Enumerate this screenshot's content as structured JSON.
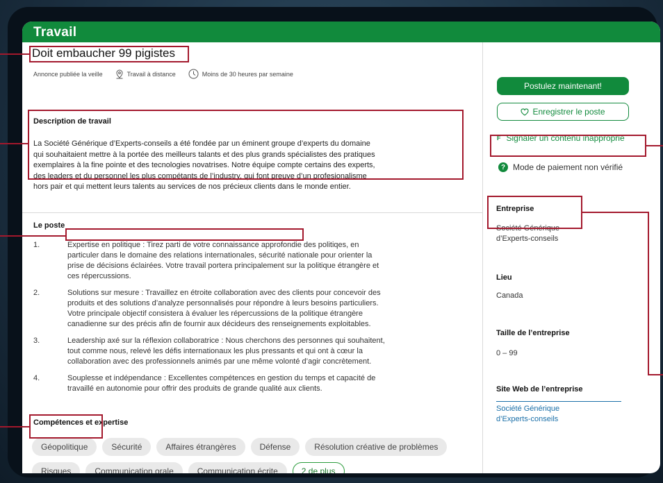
{
  "window": {
    "title": "Travail"
  },
  "job": {
    "title": "Doit embaucher 99 pigistes",
    "posted": "Annonce publiée la veille",
    "location": "Travail à distance",
    "hours": "Moins de 30 heures par semaine"
  },
  "description": {
    "heading": "Description de travail",
    "lines": [
      "La Société Générique d’Experts-conseils a été fondée par un éminent groupe d’experts du domaine",
      "qui souhaitaient mettre à la portée des meilleurs talants et des plus grands spécialistes des pratiques",
      "exemplaires à la fine pointe et des tecnologies novatrises. Notre équipe compte certains des experts,",
      "des leaders et du personnel les plus compétants de l’industry, qui font preuve d’un profesionalisme",
      "hors pair et qui mettent leurs talents au services de nos précieux clients dans le monde entier."
    ]
  },
  "poste": {
    "heading": "Le poste",
    "items": [
      {
        "num": "1.",
        "lines": [
          "Expertise en politique : Tirez parti de votre connaissance approfondie des politiqes, en",
          "particuler dans le domaine des relations internationales, sécurité nationale pour orienter la",
          "prise de décisions éclairées. Votre travail portera principalement sur la politique étrangère et",
          "ces répercussions."
        ]
      },
      {
        "num": "2.",
        "lines": [
          "Solutions sur mesure : Travaillez en étroite collaboration avec des clients pour concevoir des",
          "produits et des solutions d’analyze personnalisés pour répondre à leurs besoins particuliers.",
          "Votre principale objectif consistera à évaluer les répercussions de la politique étrangère",
          "canadienne sur des précis afin de fournir aux décideurs des renseignements exploitables."
        ]
      },
      {
        "num": "3.",
        "lines": [
          "Leadership axé sur la réflexion collaboratrice : Nous cherchons des personnes qui souhaitent,",
          "tout comme nous, relevé les défis internationaux les plus pressants et qui ont à cœur la",
          "collaboration avec des professionnels animés par une même volonté d’agir concrètement."
        ]
      },
      {
        "num": "4.",
        "lines": [
          "Souplesse et indépendance : Excellentes compétences en gestion du temps et capacité de",
          "travaillé en autonomie pour offrir des produits de grande qualité aux clients."
        ]
      }
    ]
  },
  "skills": {
    "heading": "Compétences et expertise",
    "tags": [
      "Géopolitique",
      "Sécurité",
      "Affaires étrangères",
      "Défense",
      "Résolution créative de problèmes",
      "Risques",
      "Communication orale",
      "Communication écrite"
    ],
    "more": "2 de plus"
  },
  "sidebar": {
    "apply": "Postulez maintenant!",
    "save": "Enregistrer le poste",
    "report_flag": "F",
    "report": "Signaler un contenu inapproprié",
    "payment_icon": "?",
    "payment": "Mode de paiement non vérifié",
    "company_label": "Entreprise",
    "company_lines": [
      "Société Générique",
      "d’Experts-conseils"
    ],
    "location_label": "Lieu",
    "location": "Canada",
    "size_label": "Taille de l’entreprise",
    "size": "0 –  99",
    "site_label": "Site Web de l’entreprise",
    "site_lines": [
      "Société Générique",
      "d’Experts-conseils"
    ]
  },
  "colors": {
    "accent": "#118a3c",
    "highlight": "#a3182c",
    "link": "#1a6fa8"
  }
}
